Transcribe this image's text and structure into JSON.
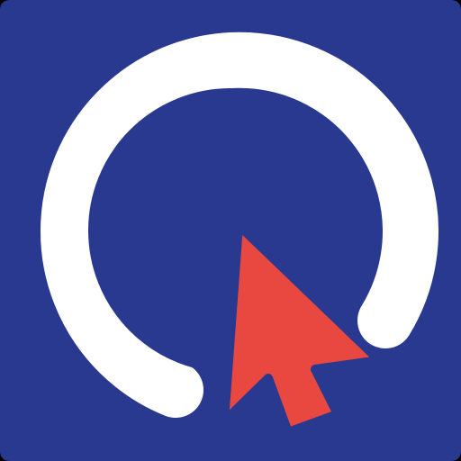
{
  "icon": {
    "name": "cursor-target-app-icon",
    "symbol": "ring-with-arrow-cursor"
  },
  "colors": {
    "background": "#2a3990",
    "ring_outer": "#ffffff",
    "ring_inner": "#2a3990",
    "cursor_fill": "#e8483f",
    "cursor_outline": "#2a3990",
    "corners": "#000000"
  }
}
